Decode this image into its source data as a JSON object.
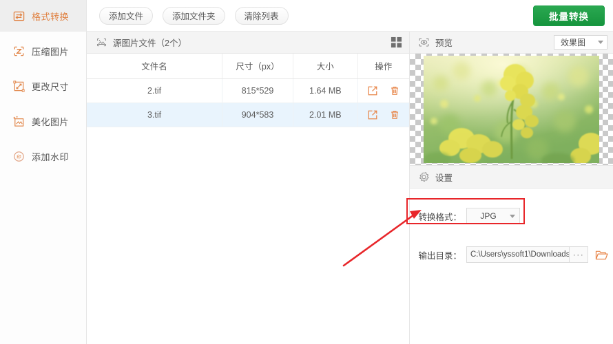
{
  "sidebar": {
    "items": [
      {
        "label": "格式转换",
        "icon": "format-convert-icon",
        "active": true
      },
      {
        "label": "压缩图片",
        "icon": "compress-image-icon",
        "active": false
      },
      {
        "label": "更改尺寸",
        "icon": "resize-image-icon",
        "active": false
      },
      {
        "label": "美化图片",
        "icon": "beautify-image-icon",
        "active": false
      },
      {
        "label": "添加水印",
        "icon": "watermark-icon",
        "active": false
      }
    ]
  },
  "toolbar": {
    "add_file_label": "添加文件",
    "add_folder_label": "添加文件夹",
    "clear_list_label": "清除列表",
    "batch_convert_label": "批量转换",
    "batch_convert_color": "#1e9e47"
  },
  "file_pane": {
    "header_icon": "image-file-icon",
    "header_title": "源图片文件（2个）",
    "grid_toggle_icon": "grid-view-icon",
    "columns": [
      "文件名",
      "尺寸（px）",
      "大小",
      "操作"
    ],
    "rows": [
      {
        "name": "2.tif",
        "dimensions": "815*529",
        "size": "1.64 MB",
        "selected": false
      },
      {
        "name": "3.tif",
        "dimensions": "904*583",
        "size": "2.01 MB",
        "selected": true
      }
    ],
    "row_actions": {
      "open_icon": "open-external-icon",
      "delete_icon": "trash-icon",
      "icon_color": "#e8864a"
    },
    "selected_row_color": "#e9f4fd"
  },
  "preview": {
    "header_icon": "eye-preview-icon",
    "header_title": "预览",
    "mode_select_value": "效果图",
    "image_alt": "rapeseed-flower-field-photo"
  },
  "settings": {
    "header_icon": "gear-icon",
    "header_title": "设置",
    "format_label": "转换格式：",
    "format_value": "JPG",
    "output_label": "输出目录：",
    "output_value": "C:\\Users\\yssoft1\\Downloads",
    "browse_dots_label": "···",
    "folder_icon": "folder-open-icon"
  },
  "annotations": {
    "highlight_color": "#e8262a",
    "highlight_target": "转换格式：",
    "arrow_color": "#e8262a"
  }
}
